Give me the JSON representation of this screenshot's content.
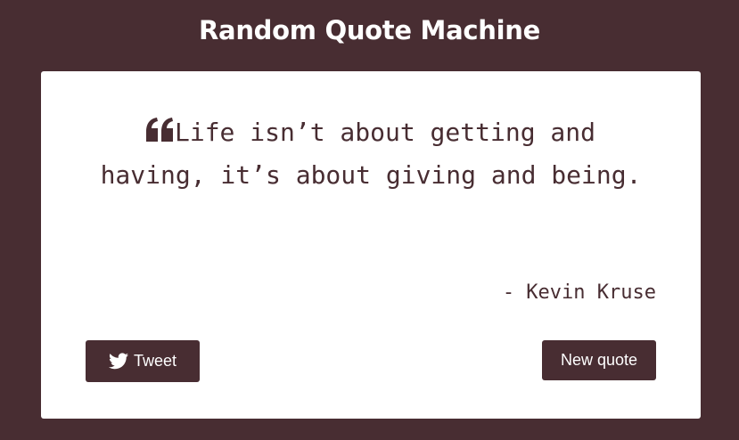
{
  "header": {
    "title": "Random Quote Machine"
  },
  "quote": {
    "icon": "quote-left-icon",
    "text": "Life isn’t about getting and having, it’s about giving and being.",
    "author": "- Kevin Kruse"
  },
  "actions": {
    "tweet_icon": "twitter-icon",
    "tweet_label": "Tweet",
    "new_quote_label": "New quote"
  },
  "colors": {
    "background": "#482d32",
    "card": "#ffffff",
    "accent": "#482d32",
    "button_text": "#ffffff"
  }
}
